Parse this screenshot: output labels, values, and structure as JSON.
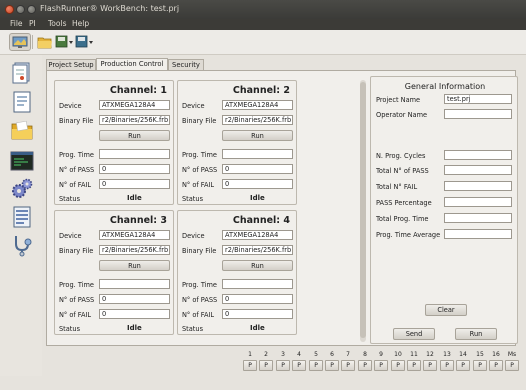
{
  "window": {
    "title": "FlashRunner® WorkBench: test.prj"
  },
  "menu": [
    "File",
    "PI",
    "Tools",
    "Help"
  ],
  "sidebar_icons": [
    "pages-icon",
    "document-icon",
    "folder-icon",
    "terminal-icon",
    "gears-icon",
    "list-icon",
    "stethoscope-icon"
  ],
  "tabs": [
    {
      "label": "Project Setup",
      "active": false
    },
    {
      "label": "Production Control",
      "active": true
    },
    {
      "label": "Security",
      "active": false
    }
  ],
  "channel_labels": {
    "device": "Device",
    "binary_file": "Binary File",
    "run": "Run",
    "prog_time": "Prog. Time",
    "n_pass": "N° of PASS",
    "n_fail": "N° of FAIL",
    "status": "Status"
  },
  "channels": [
    {
      "title": "Channel: 1",
      "device": "ATXMEGA128A4",
      "binary_file": "r2/Binaries/256K.frb",
      "prog_time": "",
      "n_pass": "0",
      "n_fail": "0",
      "status": "Idle"
    },
    {
      "title": "Channel: 2",
      "device": "ATXMEGA128A4",
      "binary_file": "r2/Binaries/256K.frb",
      "prog_time": "",
      "n_pass": "0",
      "n_fail": "0",
      "status": "Idle"
    },
    {
      "title": "Channel: 3",
      "device": "ATXMEGA128A4",
      "binary_file": "r2/Binaries/256K.frb",
      "prog_time": "",
      "n_pass": "0",
      "n_fail": "0",
      "status": "Idle"
    },
    {
      "title": "Channel: 4",
      "device": "ATXMEGA128A4",
      "binary_file": "r2/Binaries/256K.frb",
      "prog_time": "",
      "n_pass": "0",
      "n_fail": "0",
      "status": "Idle"
    }
  ],
  "general_info": {
    "title": "General Information",
    "project_name_label": "Project Name",
    "project_name": "test.prj",
    "operator_name_label": "Operator Name",
    "operator_name": "",
    "stats": [
      {
        "label": "N. Prog. Cycles",
        "value": ""
      },
      {
        "label": "Total N° of PASS",
        "value": ""
      },
      {
        "label": "Total N° FAIL",
        "value": ""
      },
      {
        "label": "PASS Percentage",
        "value": ""
      },
      {
        "label": "Total Prog. Time",
        "value": ""
      },
      {
        "label": "Prog. Time Average",
        "value": ""
      }
    ],
    "clear_label": "Clear",
    "send_label": "Send",
    "run_label": "Run"
  },
  "slots": {
    "numbers": [
      "1",
      "2",
      "3",
      "4",
      "5",
      "6",
      "7",
      "8",
      "9",
      "10",
      "11",
      "12",
      "13",
      "14",
      "15",
      "16",
      "Ms"
    ],
    "button_label": "P"
  }
}
